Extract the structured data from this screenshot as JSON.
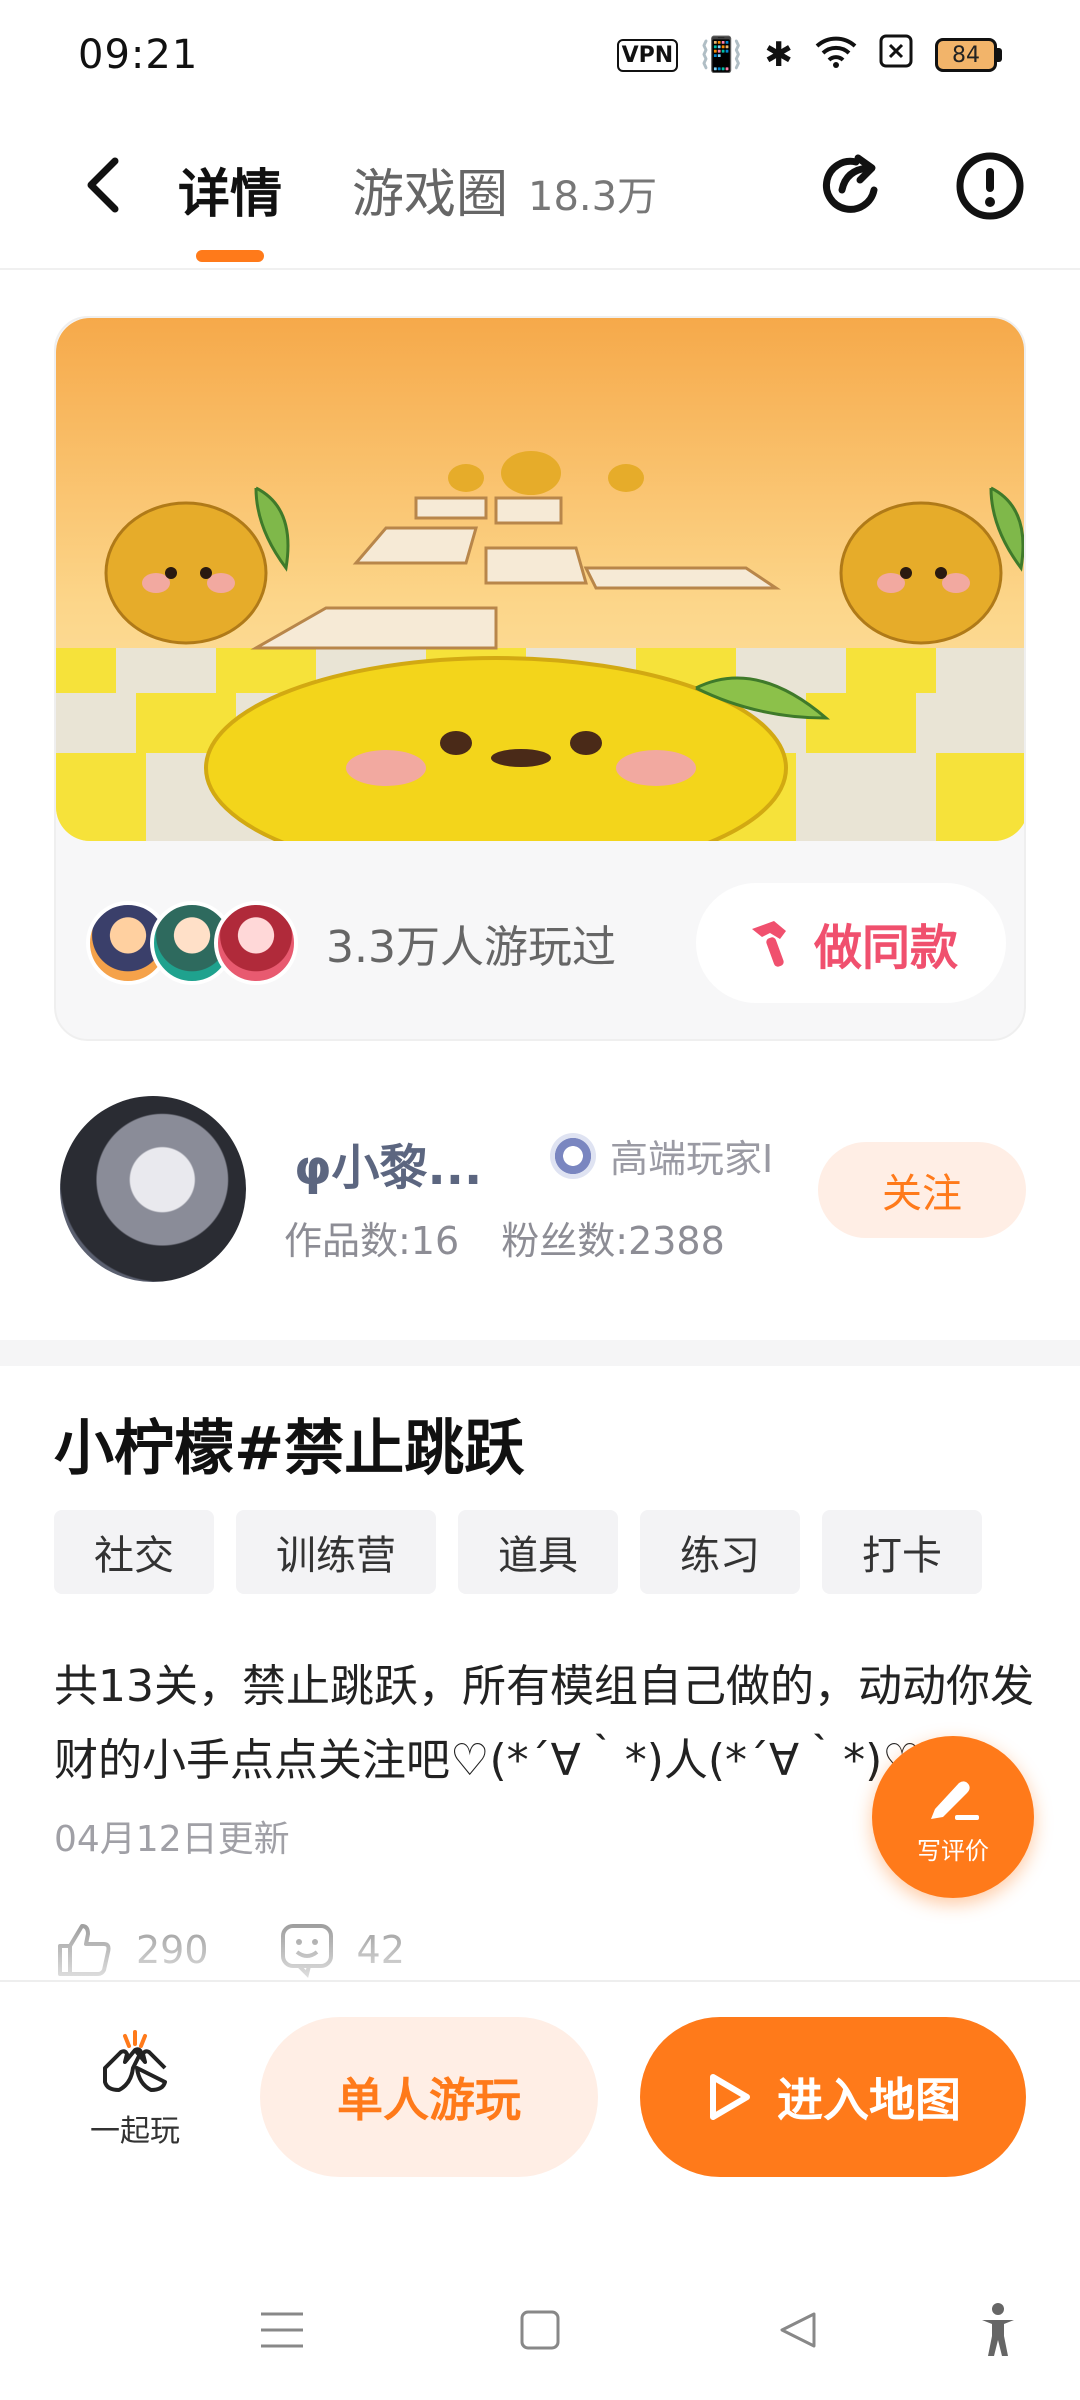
{
  "status_bar": {
    "time": "09:21",
    "battery": "84",
    "icons": [
      "vpn-icon",
      "vibrate-icon",
      "bluetooth-icon",
      "wifi-icon",
      "close-box-icon",
      "battery-icon"
    ]
  },
  "nav": {
    "tab_detail": "详情",
    "tab_circle": "游戏圈",
    "circle_count": "18.3万",
    "accent_color": "#ff7a1a"
  },
  "map_card": {
    "players_text": "3.3万人游玩过",
    "make_same_label": "做同款"
  },
  "author": {
    "name": "φ小黎...",
    "badge": "高端玩家I",
    "works_label": "作品数:16",
    "fans_label": "粉丝数:2388",
    "follow_label": "关注"
  },
  "detail": {
    "title": "小柠檬#禁止跳跃",
    "tags": [
      "社交",
      "训练营",
      "道具",
      "练习",
      "打卡"
    ],
    "description": "共13关，禁止跳跃，所有模组自己做的，动动你发财的小手点点关注吧♡(*´∀｀*)人(*´∀｀*)♡",
    "updated": "04月12日更新"
  },
  "interactions": {
    "likes": "290",
    "comments": "42"
  },
  "fab": {
    "review_label": "写评价"
  },
  "bottom_bar": {
    "play_together": "一起玩",
    "solo_play": "单人游玩",
    "enter_map": "进入地图"
  }
}
